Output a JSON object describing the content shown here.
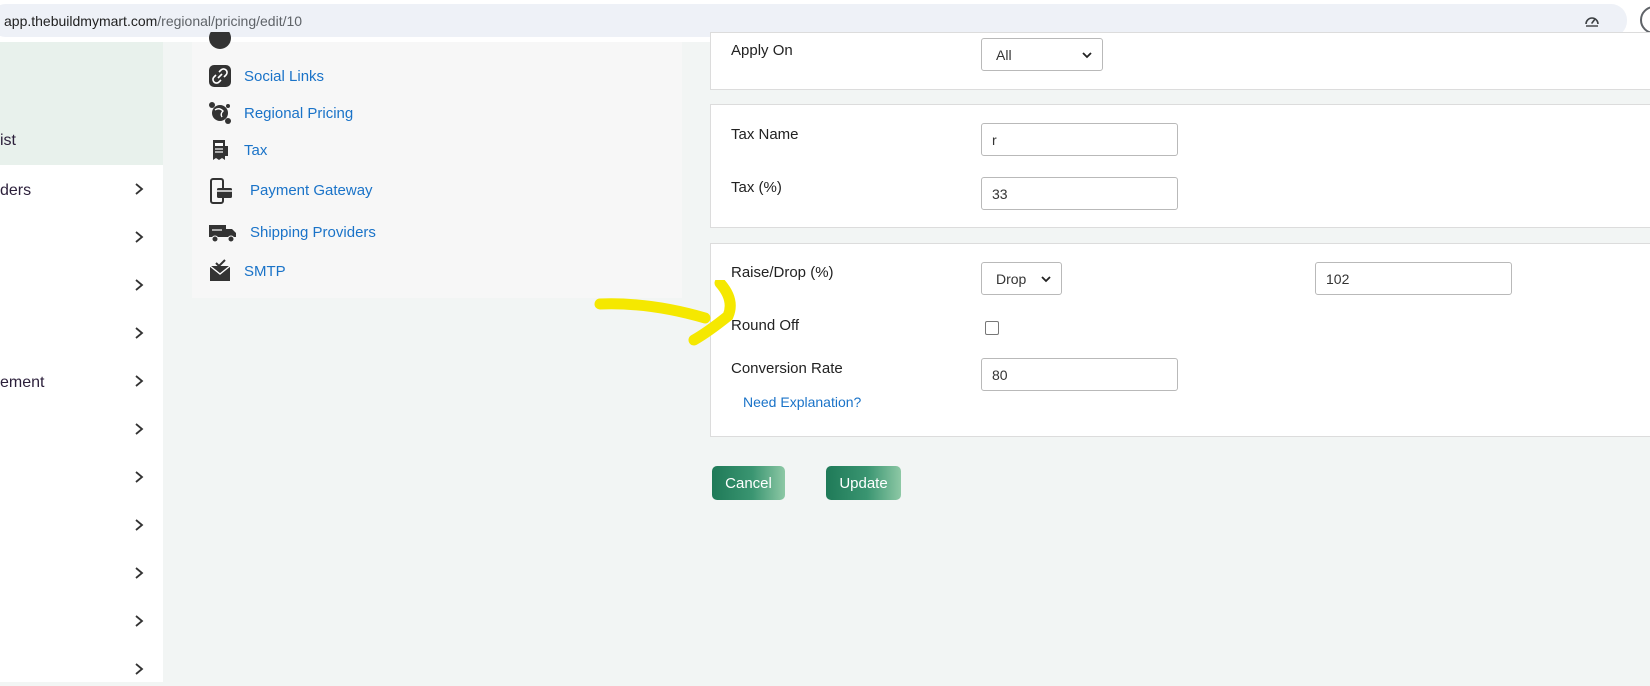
{
  "browser": {
    "url_host": "app.thebuildmymart.com",
    "url_path": "/regional/pricing/edit/10",
    "icons": [
      "speed-gauge-icon",
      "profile-circle-icon"
    ]
  },
  "leftnav": {
    "items": [
      {
        "label": "ist",
        "active": true,
        "chevron": false
      },
      {
        "label": "ders",
        "chevron": true
      },
      {
        "label": "",
        "chevron": true
      },
      {
        "label": "",
        "chevron": true
      },
      {
        "label": "",
        "chevron": true
      },
      {
        "label": "ement",
        "chevron": true
      },
      {
        "label": "",
        "chevron": true
      },
      {
        "label": "",
        "chevron": true
      },
      {
        "label": "",
        "chevron": true
      },
      {
        "label": "",
        "chevron": true
      },
      {
        "label": "",
        "chevron": true
      },
      {
        "label": "",
        "chevron": true
      }
    ]
  },
  "submenu": {
    "items": [
      {
        "label": "Social Links",
        "icon": "link-icon"
      },
      {
        "label": "Regional Pricing",
        "icon": "globe-pricing-icon"
      },
      {
        "label": "Tax",
        "icon": "tax-receipt-icon"
      },
      {
        "label": "Payment Gateway",
        "icon": "payment-card-icon"
      },
      {
        "label": "Shipping Providers",
        "icon": "delivery-truck-icon"
      },
      {
        "label": "SMTP",
        "icon": "mail-icon"
      }
    ]
  },
  "form": {
    "apply_on": {
      "label": "Apply On",
      "value": "All"
    },
    "tax_name": {
      "label": "Tax Name",
      "value": "r"
    },
    "tax_percent": {
      "label": "Tax (%)",
      "value": "33"
    },
    "raise_drop": {
      "label": "Raise/Drop (%)",
      "mode": "Drop",
      "value": "102"
    },
    "round_off": {
      "label": "Round Off",
      "checked": false
    },
    "conversion_rate": {
      "label": "Conversion Rate",
      "value": "80"
    },
    "explanation_link": "Need Explanation?"
  },
  "buttons": {
    "cancel": "Cancel",
    "update": "Update"
  },
  "colors": {
    "link": "#1a73c8",
    "button_start": "#1f7a58",
    "button_end": "#8dc8a5",
    "annotation": "#f5e800",
    "nav_active_bg": "#e8f1ec"
  }
}
